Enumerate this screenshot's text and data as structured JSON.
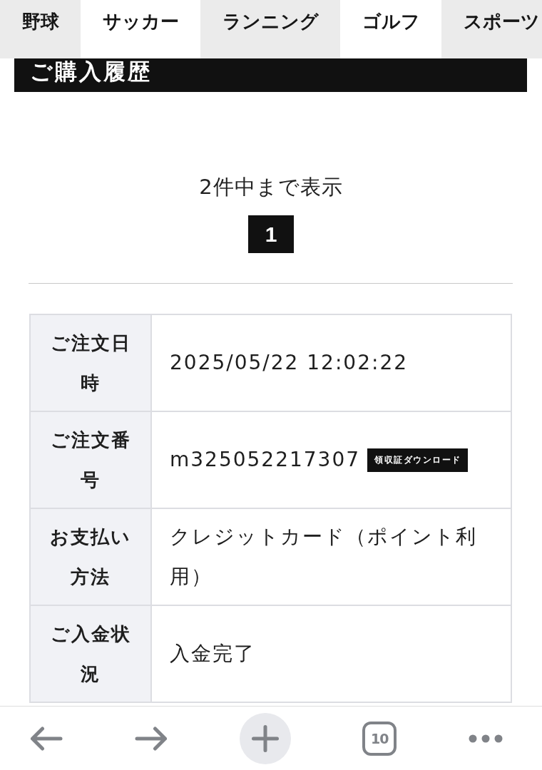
{
  "tabs": [
    {
      "label": "野球"
    },
    {
      "label": "サッカー"
    },
    {
      "label": "ランニング"
    },
    {
      "label": "ゴルフ"
    },
    {
      "label": "スポーツ"
    }
  ],
  "page_title": "ご購入履歴",
  "result_summary": "2件中まで表示",
  "pagination": [
    {
      "label": "1",
      "selected": true
    }
  ],
  "order_table": [
    {
      "label": "ご注文日時",
      "value": "2025/05/22 12:02:22"
    },
    {
      "label": "ご注文番号",
      "value": "m325052217307",
      "button": "領収証ダウンロード"
    },
    {
      "label": "お支払い方法",
      "value": "クレジットカード（ポイント利用）"
    },
    {
      "label": "ご入金状況",
      "value": "入金完了"
    }
  ],
  "browser_toolbar": {
    "tab_count": "10"
  }
}
